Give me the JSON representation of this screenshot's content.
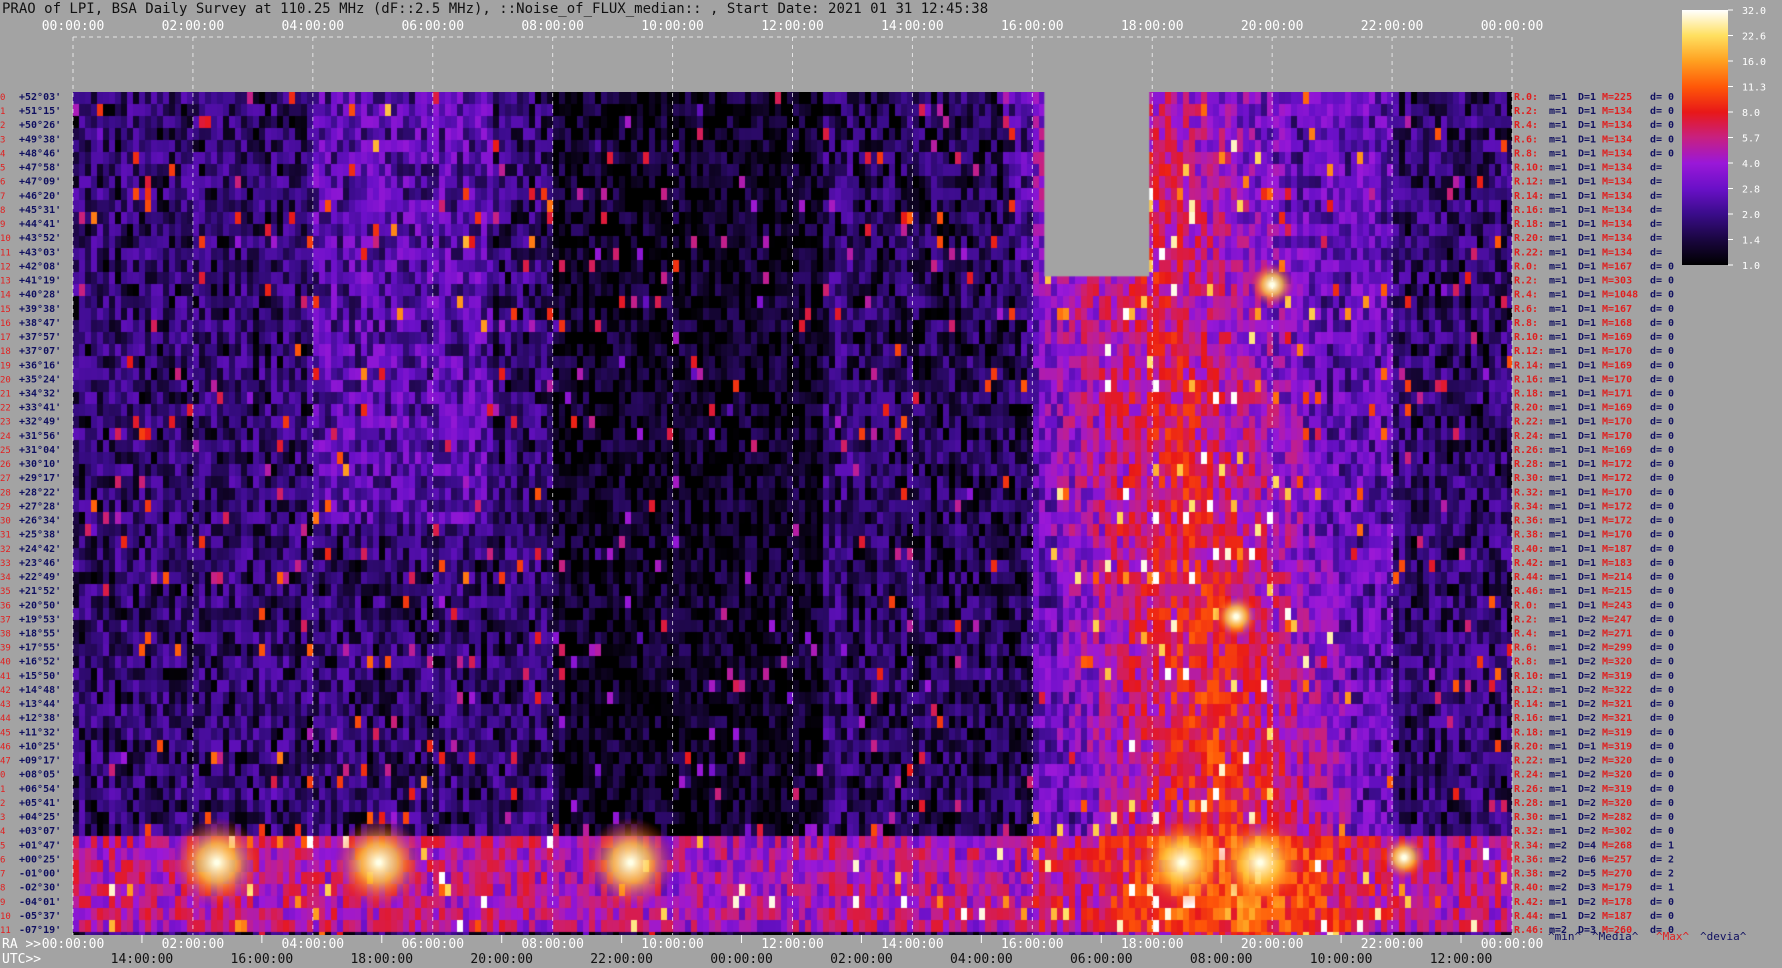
{
  "title": "PRAO of LPI, BSA Daily Survey at 110.25 MHz (dF::2.5 MHz), ::Noise_of_FLUX_median:: , Start Date: 2021 01 31 12:45:38",
  "chart_data": {
    "type": "heatmap",
    "title": "PRAO of LPI, BSA Daily Survey at 110.25 MHz (dF::2.5 MHz), ::Noise_of_FLUX_median:: , Start Date: 2021 01 31 12:45:38",
    "x_top_ticks": [
      "00:00:00",
      "02:00:00",
      "04:00:00",
      "06:00:00",
      "08:00:00",
      "10:00:00",
      "12:00:00",
      "14:00:00",
      "16:00:00",
      "18:00:00",
      "20:00:00",
      "22:00:00",
      "00:00:00"
    ],
    "x_bottom_prefix_ra": "RA >>",
    "x_bottom_ra_ticks": [
      "00:00:00",
      "02:00:00",
      "04:00:00",
      "06:00:00",
      "08:00:00",
      "10:00:00",
      "12:00:00",
      "14:00:00",
      "16:00:00",
      "18:00:00",
      "20:00:00",
      "22:00:00",
      "00:00:00"
    ],
    "x_bottom_prefix_utc": "UTC>>",
    "x_bottom_utc_ticks": [
      "14:00:00",
      "16:00:00",
      "18:00:00",
      "20:00:00",
      "22:00:00",
      "00:00:00",
      "02:00:00",
      "04:00:00",
      "06:00:00",
      "08:00:00",
      "10:00:00",
      "12:00:00"
    ],
    "y_dec_labels": [
      "+52°03'",
      "+51°15'",
      "+50°26'",
      "+49°38'",
      "+48°46'",
      "+47°58'",
      "+47°09'",
      "+46°20'",
      "+45°31'",
      "+44°41'",
      "+43°52'",
      "+43°03'",
      "+42°08'",
      "+41°19'",
      "+40°28'",
      "+39°38'",
      "+38°47'",
      "+37°57'",
      "+37°07'",
      "+36°16'",
      "+35°24'",
      "+34°32'",
      "+33°41'",
      "+32°49'",
      "+31°56'",
      "+31°04'",
      "+30°10'",
      "+29°17'",
      "+28°22'",
      "+27°28'",
      "+26°34'",
      "+25°38'",
      "+24°42'",
      "+23°46'",
      "+22°49'",
      "+21°52'",
      "+20°50'",
      "+19°53'",
      "+18°55'",
      "+17°55'",
      "+16°52'",
      "+15°50'",
      "+14°48'",
      "+13°44'",
      "+12°38'",
      "+11°32'",
      "+10°25'",
      "+09°17'",
      "+08°05'",
      "+06°54'",
      "+05°41'",
      "+04°25'",
      "+03°07'",
      "+01°47'",
      "+00°25'",
      "-01°00'",
      "-02°30'",
      "-04°01'",
      "-05°37'",
      "-07°19'"
    ],
    "beam_labels": [
      {
        "r": "R.0:",
        "m": "1",
        "d": "1",
        "M": "225",
        "dv": "0"
      },
      {
        "r": "R.2:",
        "m": "1",
        "d": "1",
        "M": "134",
        "dv": "0"
      },
      {
        "r": "R.4:",
        "m": "1",
        "d": "1",
        "M": "134",
        "dv": "0"
      },
      {
        "r": "R.6:",
        "m": "1",
        "d": "1",
        "M": "134",
        "dv": "0"
      },
      {
        "r": "R.8:",
        "m": "1",
        "d": "1",
        "M": "134",
        "dv": "0"
      },
      {
        "r": "R.10:",
        "m": "1",
        "d": "1",
        "M": "134",
        "dv": ""
      },
      {
        "r": "R.12:",
        "m": "1",
        "d": "1",
        "M": "134",
        "dv": ""
      },
      {
        "r": "R.14:",
        "m": "1",
        "d": "1",
        "M": "134",
        "dv": ""
      },
      {
        "r": "R.16:",
        "m": "1",
        "d": "1",
        "M": "134",
        "dv": ""
      },
      {
        "r": "R.18:",
        "m": "1",
        "d": "1",
        "M": "134",
        "dv": ""
      },
      {
        "r": "R.20:",
        "m": "1",
        "d": "1",
        "M": "134",
        "dv": ""
      },
      {
        "r": "R.22:",
        "m": "1",
        "d": "1",
        "M": "134",
        "dv": ""
      },
      {
        "r": "R.0:",
        "m": "1",
        "d": "1",
        "M": "167",
        "dv": "0"
      },
      {
        "r": "R.2:",
        "m": "1",
        "d": "1",
        "M": "303",
        "dv": "0"
      },
      {
        "r": "R.4:",
        "m": "1",
        "d": "1",
        "M": "1048",
        "dv": "0"
      },
      {
        "r": "R.6:",
        "m": "1",
        "d": "1",
        "M": "167",
        "dv": "0"
      },
      {
        "r": "R.8:",
        "m": "1",
        "d": "1",
        "M": "168",
        "dv": "0"
      },
      {
        "r": "R.10:",
        "m": "1",
        "d": "1",
        "M": "169",
        "dv": "0"
      },
      {
        "r": "R.12:",
        "m": "1",
        "d": "1",
        "M": "170",
        "dv": "0"
      },
      {
        "r": "R.14:",
        "m": "1",
        "d": "1",
        "M": "169",
        "dv": "0"
      },
      {
        "r": "R.16:",
        "m": "1",
        "d": "1",
        "M": "170",
        "dv": "0"
      },
      {
        "r": "R.18:",
        "m": "1",
        "d": "1",
        "M": "171",
        "dv": "0"
      },
      {
        "r": "R.20:",
        "m": "1",
        "d": "1",
        "M": "169",
        "dv": "0"
      },
      {
        "r": "R.22:",
        "m": "1",
        "d": "1",
        "M": "170",
        "dv": "0"
      },
      {
        "r": "R.24:",
        "m": "1",
        "d": "1",
        "M": "170",
        "dv": "0"
      },
      {
        "r": "R.26:",
        "m": "1",
        "d": "1",
        "M": "169",
        "dv": "0"
      },
      {
        "r": "R.28:",
        "m": "1",
        "d": "1",
        "M": "172",
        "dv": "0"
      },
      {
        "r": "R.30:",
        "m": "1",
        "d": "1",
        "M": "172",
        "dv": "0"
      },
      {
        "r": "R.32:",
        "m": "1",
        "d": "1",
        "M": "170",
        "dv": "0"
      },
      {
        "r": "R.34:",
        "m": "1",
        "d": "1",
        "M": "172",
        "dv": "0"
      },
      {
        "r": "R.36:",
        "m": "1",
        "d": "1",
        "M": "172",
        "dv": "0"
      },
      {
        "r": "R.38:",
        "m": "1",
        "d": "1",
        "M": "170",
        "dv": "0"
      },
      {
        "r": "R.40:",
        "m": "1",
        "d": "1",
        "M": "187",
        "dv": "0"
      },
      {
        "r": "R.42:",
        "m": "1",
        "d": "1",
        "M": "183",
        "dv": "0"
      },
      {
        "r": "R.44:",
        "m": "1",
        "d": "1",
        "M": "214",
        "dv": "0"
      },
      {
        "r": "R.46:",
        "m": "1",
        "d": "1",
        "M": "215",
        "dv": "0"
      },
      {
        "r": "R.0:",
        "m": "1",
        "d": "1",
        "M": "243",
        "dv": "0"
      },
      {
        "r": "R.2:",
        "m": "1",
        "d": "2",
        "M": "247",
        "dv": "0"
      },
      {
        "r": "R.4:",
        "m": "1",
        "d": "2",
        "M": "271",
        "dv": "0"
      },
      {
        "r": "R.6:",
        "m": "1",
        "d": "2",
        "M": "299",
        "dv": "0"
      },
      {
        "r": "R.8:",
        "m": "1",
        "d": "2",
        "M": "320",
        "dv": "0"
      },
      {
        "r": "R.10:",
        "m": "1",
        "d": "2",
        "M": "319",
        "dv": "0"
      },
      {
        "r": "R.12:",
        "m": "1",
        "d": "2",
        "M": "322",
        "dv": "0"
      },
      {
        "r": "R.14:",
        "m": "1",
        "d": "2",
        "M": "321",
        "dv": "0"
      },
      {
        "r": "R.16:",
        "m": "1",
        "d": "2",
        "M": "321",
        "dv": "0"
      },
      {
        "r": "R.18:",
        "m": "1",
        "d": "2",
        "M": "319",
        "dv": "0"
      },
      {
        "r": "R.20:",
        "m": "1",
        "d": "1",
        "M": "319",
        "dv": "0"
      },
      {
        "r": "R.22:",
        "m": "1",
        "d": "2",
        "M": "320",
        "dv": "0"
      },
      {
        "r": "R.24:",
        "m": "1",
        "d": "2",
        "M": "320",
        "dv": "0"
      },
      {
        "r": "R.26:",
        "m": "1",
        "d": "2",
        "M": "319",
        "dv": "0"
      },
      {
        "r": "R.28:",
        "m": "1",
        "d": "2",
        "M": "320",
        "dv": "0"
      },
      {
        "r": "R.30:",
        "m": "1",
        "d": "2",
        "M": "282",
        "dv": "0"
      },
      {
        "r": "R.32:",
        "m": "1",
        "d": "2",
        "M": "302",
        "dv": "0"
      },
      {
        "r": "R.34:",
        "m": "2",
        "d": "4",
        "M": "268",
        "dv": "1"
      },
      {
        "r": "R.36:",
        "m": "2",
        "d": "6",
        "M": "257",
        "dv": "2"
      },
      {
        "r": "R.38:",
        "m": "2",
        "d": "5",
        "M": "270",
        "dv": "2"
      },
      {
        "r": "R.40:",
        "m": "2",
        "d": "3",
        "M": "179",
        "dv": "1"
      },
      {
        "r": "R.42:",
        "m": "1",
        "d": "2",
        "M": "178",
        "dv": "0"
      },
      {
        "r": "R.44:",
        "m": "1",
        "d": "2",
        "M": "187",
        "dv": "0"
      },
      {
        "r": "R.46:",
        "m": "2",
        "d": "3",
        "M": "260",
        "dv": "0"
      }
    ],
    "legend_footer": [
      "^min^",
      "^Media^",
      "^Max^",
      "^devia^"
    ],
    "colorbar": {
      "ticks": [
        "32.0",
        "22.6",
        "16.0",
        "11.3",
        "8.0",
        "5.7",
        "4.0",
        "2.8",
        "2.0",
        "1.4",
        "1.0"
      ],
      "colors": [
        "#000000",
        "#1a0640",
        "#3a0c8a",
        "#6a10c8",
        "#9a18d8",
        "#c82080",
        "#e81818",
        "#ff5808",
        "#ffa020",
        "#ffe060",
        "#ffffff"
      ]
    },
    "features": {
      "missing_block": {
        "ra_start_h": 16.2,
        "ra_end_h": 17.95,
        "dec_top": 52.05,
        "dec_bottom": 41.5
      },
      "bright_band_dec": [
        3.5,
        -7.3
      ],
      "bright_sources": [
        {
          "ra_h": 9.3,
          "dec": 0,
          "level": 32
        },
        {
          "ra_h": 18.5,
          "dec": 0,
          "level": 32
        },
        {
          "ra_h": 19.8,
          "dec": 0,
          "level": 32
        },
        {
          "ra_h": 22.2,
          "dec": 0.5,
          "level": 22.6
        },
        {
          "ra_h": 2.4,
          "dec": 0,
          "level": 16
        },
        {
          "ra_h": 5.1,
          "dec": 0,
          "level": 16
        },
        {
          "ra_h": 20,
          "dec": 41,
          "level": 32
        },
        {
          "ra_h": 19.4,
          "dec": 20,
          "level": 11.3
        }
      ]
    }
  }
}
